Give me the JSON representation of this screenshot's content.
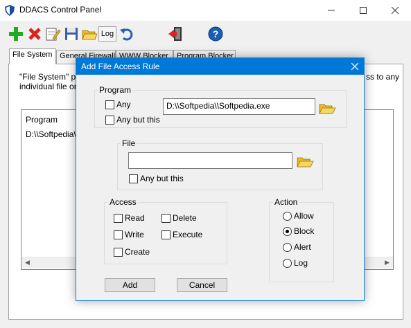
{
  "window": {
    "title": "DDACS Control Panel"
  },
  "toolbar": {
    "log_label": "Log"
  },
  "tabs": [
    "File System",
    "General Firewall",
    "WWW Blocker",
    "Program Blocker"
  ],
  "page": {
    "desc_line1": "\"File System\" par",
    "desc_line2": "individual file or fil",
    "desc_right": "ss to any"
  },
  "list": {
    "header": "Program",
    "row": "D:\\\\Softpedia\\\\"
  },
  "dialog": {
    "title": "Add File Access Rule",
    "program": {
      "group_label": "Program",
      "any_label": "Any",
      "any_but_label": "Any but this",
      "path_value": "D:\\\\Softpedia\\\\Softpedia.exe"
    },
    "file": {
      "group_label": "File",
      "path_value": "",
      "any_but_label": "Any but this"
    },
    "access": {
      "group_label": "Access",
      "read": "Read",
      "write": "Write",
      "create": "Create",
      "delete": "Delete",
      "execute": "Execute"
    },
    "action": {
      "group_label": "Action",
      "options": [
        "Allow",
        "Block",
        "Alert",
        "Log"
      ],
      "selected": "Block"
    },
    "add_label": "Add",
    "cancel_label": "Cancel"
  },
  "icons": {
    "add": "plus-icon",
    "delete": "x-icon",
    "edit": "edit-icon",
    "save": "save-icon",
    "open": "folder-open-icon",
    "undo": "undo-icon",
    "exit": "exit-icon",
    "help": "help-icon"
  },
  "colors": {
    "dialog_titlebar": "#0078d7",
    "help_icon": "#1a5fb4",
    "add_icon": "#22aa22",
    "delete_icon": "#dd2222"
  }
}
